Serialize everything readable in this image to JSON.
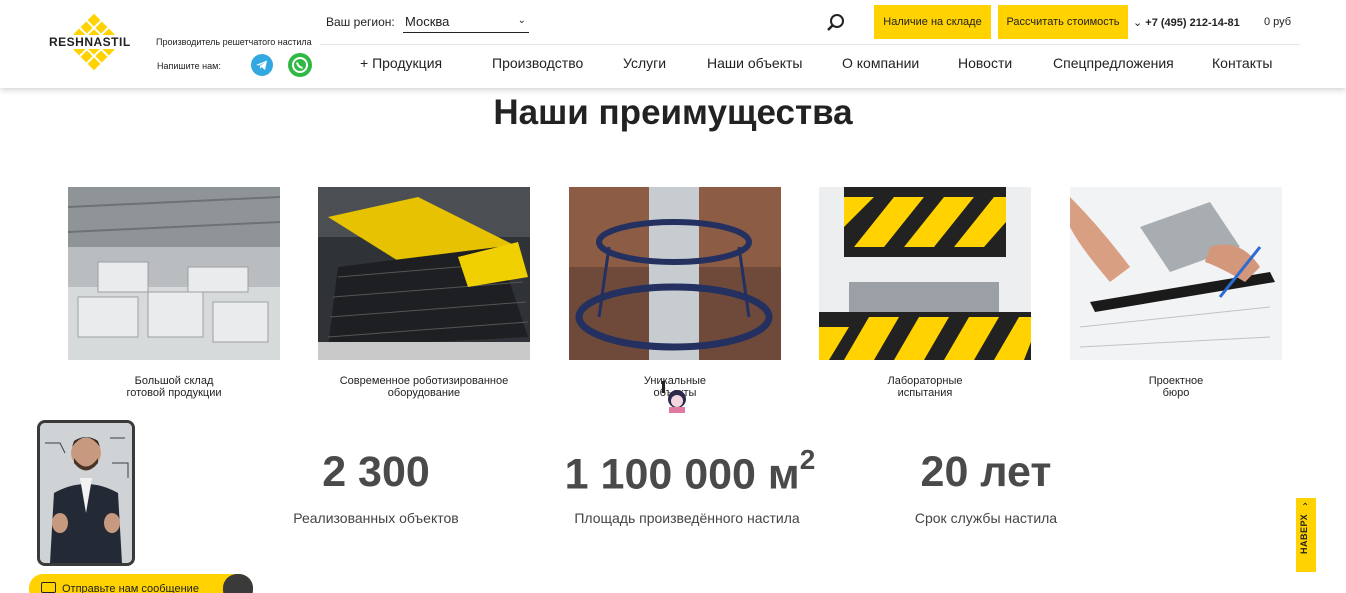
{
  "header": {
    "logo_text": "RESHNASTIL",
    "tagline": "Производитель решетчатого настила",
    "write_us": "Напишите нам:",
    "region_label": "Ваш регион:",
    "region_value": "Москва",
    "btn_stock": "Наличие на складе",
    "btn_calc": "Рассчитать стоимость",
    "phone": "+7 (495) 212-14-81",
    "cart": "0 руб",
    "colors": {
      "accent": "#ffd200",
      "telegram": "#33a8e0",
      "whatsapp": "#2fb844"
    }
  },
  "nav": {
    "items": [
      {
        "label": "+  Продукция"
      },
      {
        "label": "Производство"
      },
      {
        "label": "Услуги"
      },
      {
        "label": "Наши объекты"
      },
      {
        "label": "О компании"
      },
      {
        "label": "Новости"
      },
      {
        "label": "Спецпредложения"
      },
      {
        "label": "Контакты"
      }
    ]
  },
  "main": {
    "title": "Наши преимущества",
    "cards": [
      {
        "line1": "Большой склад",
        "line2": "готовой продукции",
        "icon": "warehouse-photo"
      },
      {
        "line1": "Современное роботизированное",
        "line2": "оборудование",
        "icon": "robot-equipment-photo"
      },
      {
        "line1": "Уникальные",
        "line2": "объекты",
        "icon": "unique-objects-photo"
      },
      {
        "line1": "Лабораторные",
        "line2": "испытания",
        "icon": "press-test-photo"
      },
      {
        "line1": "Проектное",
        "line2": "бюро",
        "icon": "design-bureau-photo"
      }
    ],
    "stats": [
      {
        "number": "2 300",
        "label": "Реализованных объектов"
      },
      {
        "number": "1 100 000 м",
        "sup": "2",
        "label": "Площадь произведённого настила"
      },
      {
        "number": "20 лет",
        "label": "Срок службы настила"
      }
    ]
  },
  "widgets": {
    "message": "Отправьте нам сообщение",
    "to_top": "НАВЕРХ"
  }
}
